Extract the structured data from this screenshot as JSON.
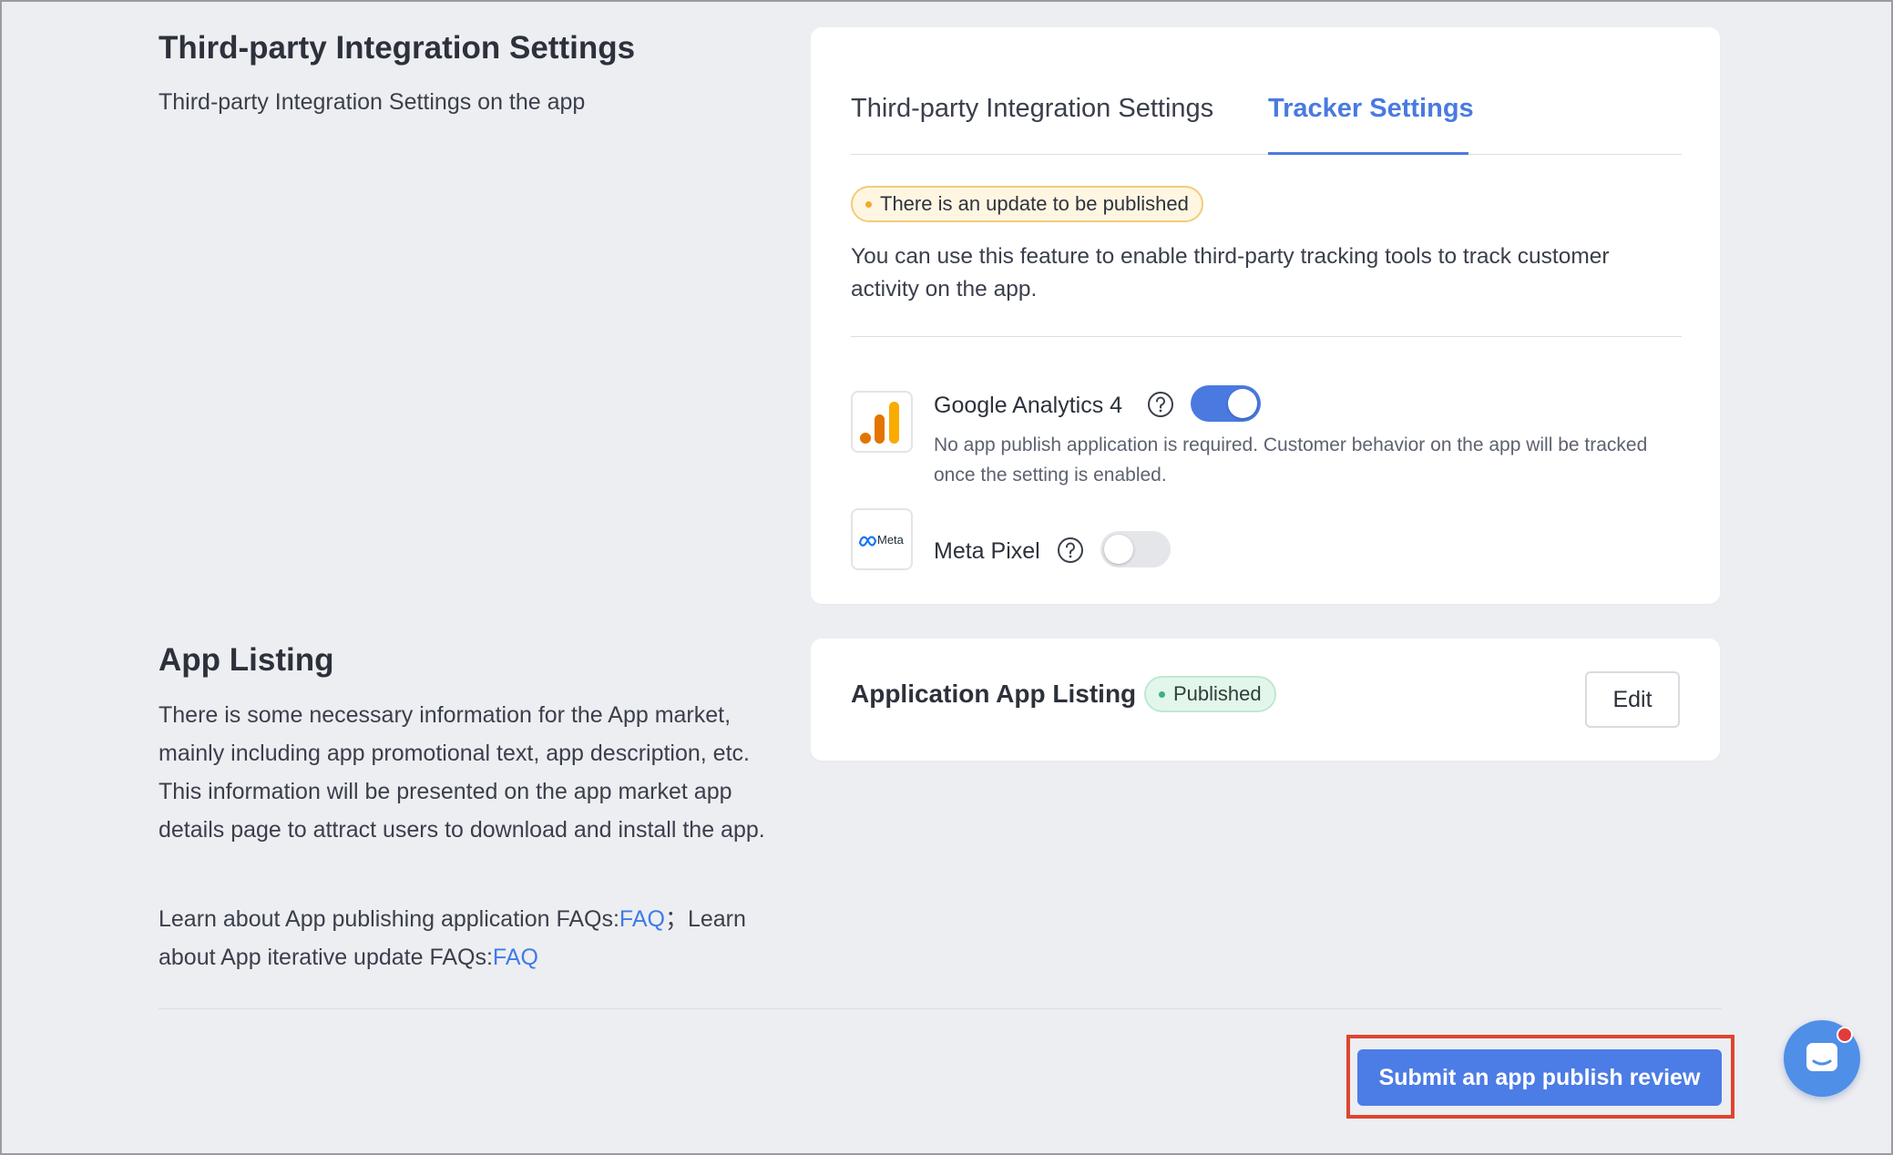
{
  "integration_section": {
    "title": "Third-party Integration Settings",
    "subtitle": "Third-party Integration Settings on the app"
  },
  "tracker_card": {
    "tabs": [
      {
        "label": "Third-party Integration Settings",
        "active": false
      },
      {
        "label": "Tracker Settings",
        "active": true
      }
    ],
    "update_badge": "There is an update to be published",
    "description": "You can use this feature to enable third-party tracking tools to track customer activity on the app.",
    "trackers": [
      {
        "name": "Google Analytics 4",
        "enabled": true,
        "logo_icon": "google-analytics-icon",
        "description": "No app publish application is required. Customer behavior on the app will be tracked once the setting is enabled."
      },
      {
        "name": "Meta Pixel",
        "enabled": false,
        "logo_icon": "meta-logo-icon",
        "logo_text": "Meta",
        "description": ""
      }
    ]
  },
  "listing_section": {
    "title": "App Listing",
    "description": "There is some necessary information for the App market, mainly including app promotional text, app description, etc. This information will be presented on the app market app details page to attract users to download and install the app.",
    "faq_text_1": "Learn about App publishing application FAQs:",
    "faq_link_1": "FAQ",
    "faq_separator": "；Learn about App iterative update FAQs:",
    "faq_link_2": "FAQ"
  },
  "listing_card": {
    "title": "Application App Listing",
    "status": "Published",
    "edit_label": "Edit"
  },
  "footer": {
    "submit_label": "Submit an app publish review"
  },
  "colors": {
    "accent": "#4a7ae0",
    "highlight": "#e0442f",
    "warning": "#f0ac2c",
    "success": "#3db27a"
  }
}
